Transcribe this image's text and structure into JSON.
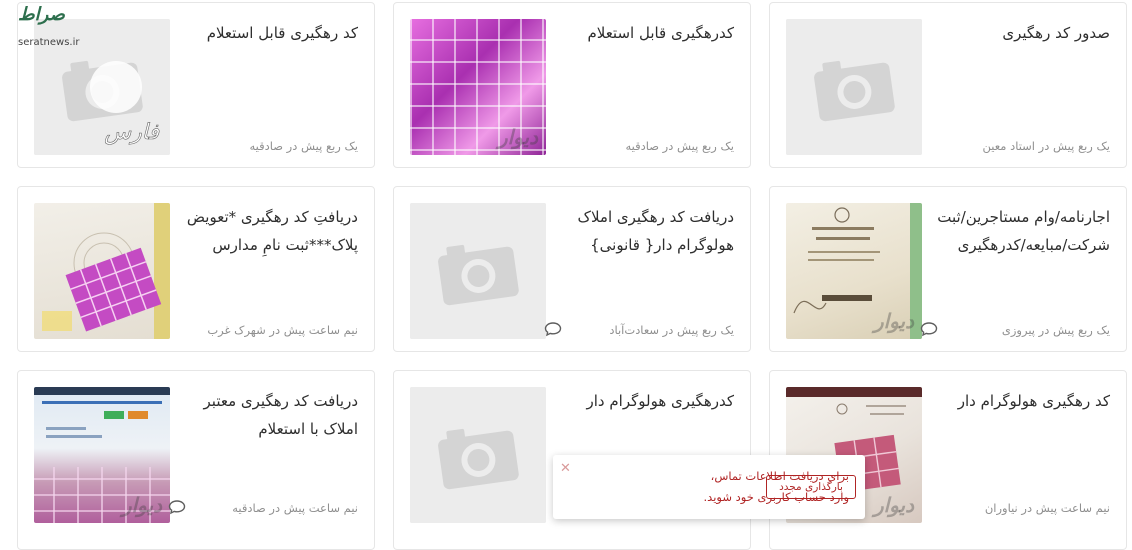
{
  "listings": [
    {
      "title": "صدور کد رهگیری",
      "meta": "یک ربع پیش در استاد معین",
      "has_chat": false,
      "thumb": "placeholder-camera"
    },
    {
      "title": "کدرهگیری قابل استعلام",
      "meta": "یک ربع پیش در صادقیه",
      "has_chat": false,
      "thumb": "hologram-photo"
    },
    {
      "title": "کد رهگیری قابل استعلام",
      "meta": "یک ربع پیش در صادقیه",
      "has_chat": false,
      "thumb": "placeholder-camera"
    },
    {
      "title": "اجارنامه/وام مستاجرین/ثبت شرکت/مبایعه/کدرهگیری",
      "meta": "یک ربع پیش در پیروزی",
      "has_chat": true,
      "thumb": "deed-photo"
    },
    {
      "title": "دریافت کد رهگیری املاک هولوگرام دار{ قانونی}",
      "meta": "یک ربع پیش در سعادت‌آباد",
      "has_chat": true,
      "thumb": "placeholder-camera"
    },
    {
      "title": "دریافتِ کد رهگیری *تعویض پلاک***ثبت نامِ مدارس",
      "meta": "نیم ساعت پیش در شهرک غرب",
      "has_chat": false,
      "thumb": "hologram-doc-photo"
    },
    {
      "title": "کد رهگیری هولوگرام دار",
      "meta": "نیم ساعت پیش در نیاوران",
      "has_chat": false,
      "thumb": "document-photo"
    },
    {
      "title": "کدرهگیری هولوگرام دار",
      "meta": "",
      "has_chat": false,
      "thumb": "placeholder-camera"
    },
    {
      "title": "دریافت کد رهگیری معتبر املاک با استعلام",
      "meta": "نیم ساعت پیش در صادقیه",
      "has_chat": true,
      "thumb": "screen-photo"
    }
  ],
  "photo_watermark": "دیوار",
  "toast": {
    "message": "برای دریافت اطلاعات تماس، وارد حساب کاربری خود شوید.",
    "button_label": "بارگذاری مجدد",
    "close_symbol": "✕"
  },
  "logo": {
    "name": "صراط",
    "url": "seratnews.ir"
  },
  "colors": {
    "accent": "#b02525",
    "text": "#2e2e2e",
    "meta": "#8f8f8f",
    "border": "#e6e6e6"
  }
}
